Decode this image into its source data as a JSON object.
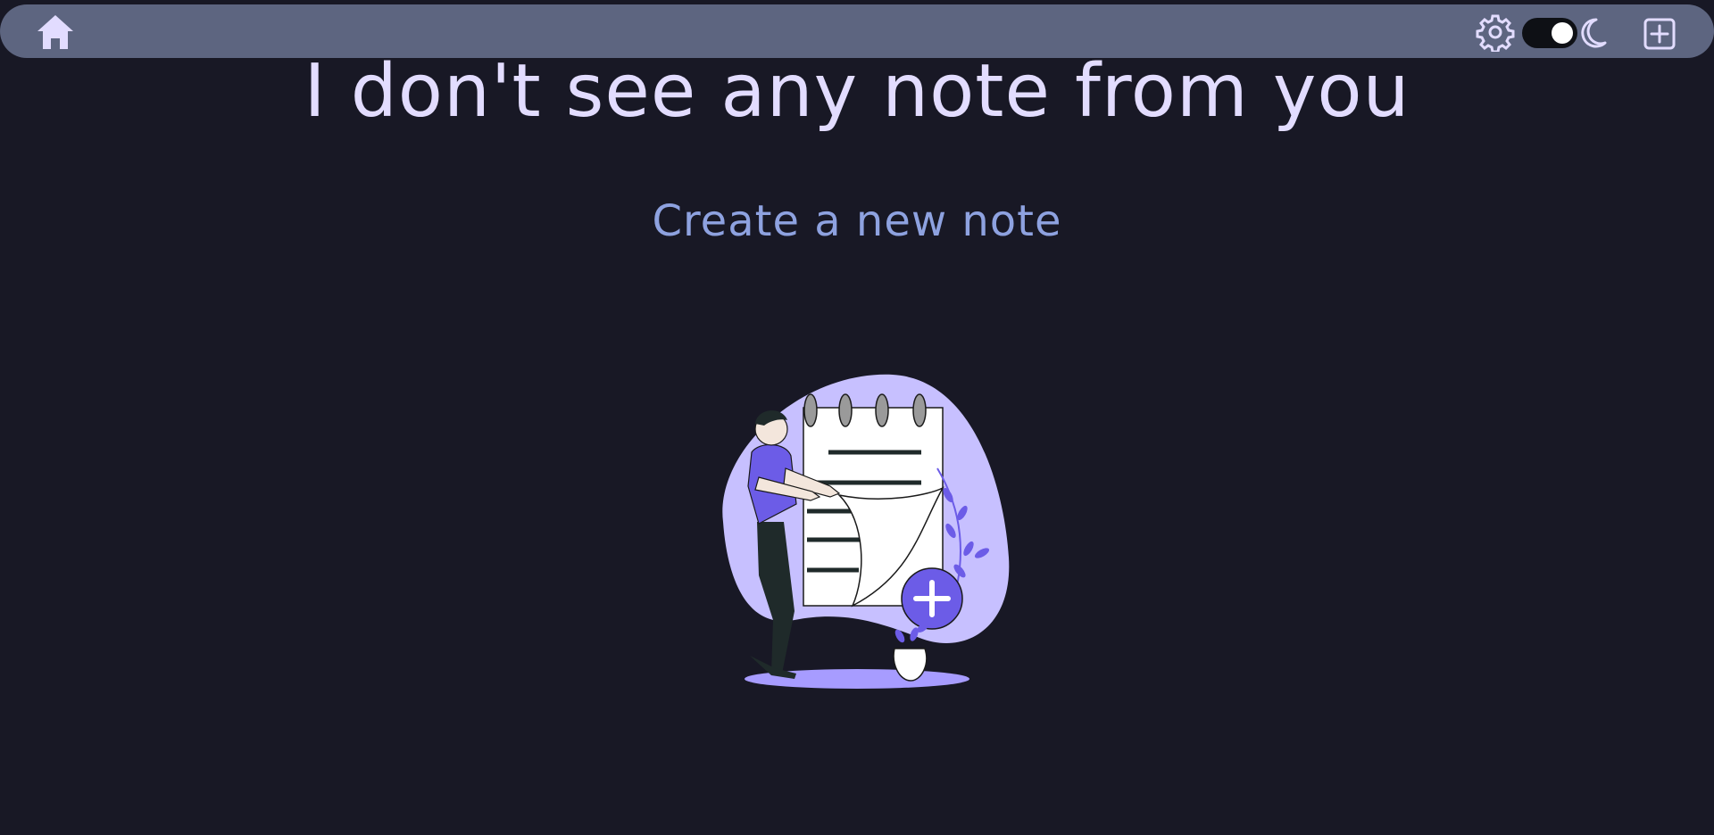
{
  "navbar": {
    "icons": {
      "home": "home-icon",
      "settings": "gear-icon",
      "theme_toggle": "toggle-switch",
      "theme_mode": "moon-icon",
      "add_note": "plus-square-icon"
    },
    "colors": {
      "bar": "#5d6580",
      "icon": "#e2dcff"
    }
  },
  "empty_state": {
    "headline": "I don't see any note from you",
    "cta": "Create a new note",
    "illustration": "man-with-notepad-illustration"
  },
  "colors": {
    "background": "#181825",
    "headline": "#e2dcff",
    "cta": "#8ea2e0",
    "accent": "#6c5ce7",
    "blob": "#c7c0ff"
  }
}
